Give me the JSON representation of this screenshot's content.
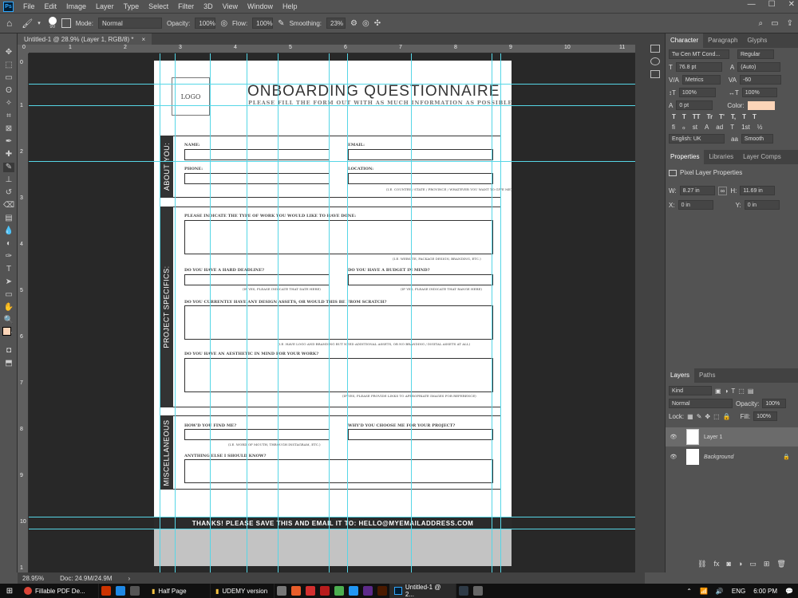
{
  "app": {
    "logo": "Ps"
  },
  "menu": [
    "File",
    "Edit",
    "Image",
    "Layer",
    "Type",
    "Select",
    "Filter",
    "3D",
    "View",
    "Window",
    "Help"
  ],
  "window_controls": {
    "minimize": "—",
    "maximize": "☐",
    "close": "✕"
  },
  "options": {
    "brush_size": "90",
    "mode_label": "Mode:",
    "mode_value": "Normal",
    "opacity_label": "Opacity:",
    "opacity_value": "100%",
    "flow_label": "Flow:",
    "flow_value": "100%",
    "smoothing_label": "Smoothing:",
    "smoothing_value": "23%"
  },
  "doc_tab": {
    "title": "Untitled-1 @ 28.9% (Layer 1, RGB/8) *",
    "close": "×"
  },
  "ruler": {
    "top": [
      "0",
      "1",
      "2",
      "3",
      "4",
      "5",
      "6",
      "7",
      "8",
      "9",
      "10",
      "11"
    ],
    "left": [
      "0",
      "1",
      "2",
      "3",
      "4",
      "5",
      "6",
      "7",
      "8",
      "9",
      "10",
      "1"
    ]
  },
  "status": {
    "zoom": "28.95%",
    "doc": "Doc: 24.9M/24.9M"
  },
  "document": {
    "logo": "LOGO",
    "title": "ONBOARDING QUESTIONNAIRE",
    "subtitle": "PLEASE FILL THE FORM OUT WITH AS MUCH INFORMATION AS POSSIBLE",
    "about": {
      "heading": "ABOUT YOU:",
      "name": "NAME:",
      "email": "EMAIL:",
      "phone": "PHONE:",
      "location": "LOCATION:",
      "location_hint": "(I.E. COUNTRY / STATE / PROVINCE / WHATEVER YOU WANT TO GIVE ME)"
    },
    "project": {
      "heading": "PROJECT SPECIFICS:",
      "work_type": "PLEASE INDICATE THE TYPE OF WORK YOU WOULD LIKE TO HAVE DONE:",
      "work_hint": "(I.E. WEBSITE, PACKAGE DESIGN, BRANDING, ETC.)",
      "deadline": "DO YOU HAVE A HARD DEADLINE?",
      "deadline_hint": "(IF YES, PLEASE INDICATE THAT DATE HERE)",
      "budget": "DO YOU HAVE A BUDGET IN MIND?",
      "budget_hint": "(IF YES, PLEASE INDICATE THAT RANGE HERE)",
      "assets": "DO YOU CURRENTLY HAVE ANY DESIGN ASSETS, OR WOULD THIS BE FROM SCRATCH?",
      "assets_hint": "(I.E. HAVE LOGO AND BRANDING BUT NEED ADDITIONAL ASSETS, OR NO BRANDING / DIGITAL ASSETS AT ALL)",
      "aesthetic": "DO YOU HAVE AN AESTHETIC IN MIND FOR YOUR WORK?",
      "aesthetic_hint": "(IF YES, PLEASE PROVIDE LINKS TO APPROPRIATE IMAGES FOR REFERENCE)"
    },
    "misc": {
      "heading": "MISCELLANEOUS",
      "found": "HOW'D YOU FIND ME?",
      "found_hint": "(I.E. WORD OF MOUTH, THROUGH INSTAGRAM, ETC.)",
      "why": "WHY'D YOU CHOOSE ME FOR YOUR PROJECT?",
      "else": "ANYTHING ELSE I SHOULD KNOW?"
    },
    "footer": "THANKS! PLEASE SAVE THIS AND EMAIL IT TO: HELLO@MYEMAILADDRESS.COM"
  },
  "character": {
    "tabs": [
      "Character",
      "Paragraph",
      "Glyphs"
    ],
    "font": "Tw Cen MT Cond...",
    "style": "Regular",
    "size": "76.8 pt",
    "leading": "(Auto)",
    "kerning": "Metrics",
    "tracking": "-60",
    "vscale": "100%",
    "hscale": "100%",
    "baseline": "0 pt",
    "color_label": "Color:",
    "color": "#fcd5b8",
    "language": "English: UK",
    "aa": "Smooth",
    "style_buttons": [
      "T",
      "T",
      "TT",
      "Tr",
      "T'",
      "T,",
      "T",
      "T"
    ],
    "ot_buttons": [
      "fi",
      "ℴ",
      "st",
      "A",
      "ad",
      "T",
      "1st",
      "½"
    ]
  },
  "properties": {
    "tabs": [
      "Properties",
      "Libraries",
      "Layer Comps"
    ],
    "title": "Pixel Layer Properties",
    "w_label": "W:",
    "w": "8.27 in",
    "h_label": "H:",
    "h": "11.69 in",
    "x_label": "X:",
    "x": "0 in",
    "y_label": "Y:",
    "y": "0 in"
  },
  "layers": {
    "tabs": [
      "Layers",
      "Paths"
    ],
    "kind": "Kind",
    "blend": "Normal",
    "opacity_label": "Opacity:",
    "opacity": "100%",
    "lock_label": "Lock:",
    "fill_label": "Fill:",
    "fill": "100%",
    "items": [
      {
        "name": "Layer 1"
      },
      {
        "name": "Background"
      }
    ]
  },
  "taskbar": {
    "tasks": [
      "Fillable PDF De...",
      "Half Page",
      "UDEMY version",
      "Untitled-1 @ 2..."
    ],
    "lang": "ENG",
    "time": "6:00 PM"
  },
  "colors": {
    "foreground": "#fcd5b8",
    "guide": "#56d6e6"
  }
}
